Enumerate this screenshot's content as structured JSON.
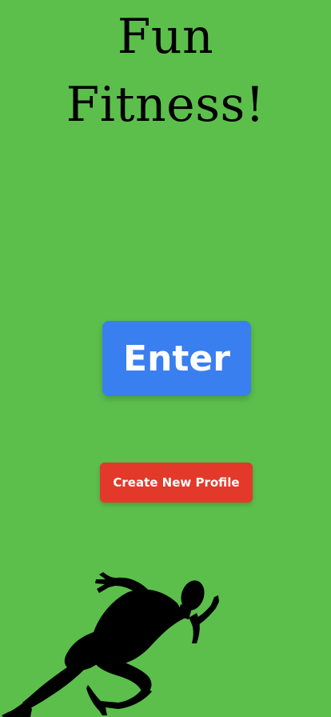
{
  "app": {
    "title_line_1": "Fun",
    "title_line_2": "Fitness!"
  },
  "actions": {
    "enter_label": "Enter",
    "create_profile_label": "Create New Profile"
  },
  "illustration": {
    "icon": "runner-silhouette-icon"
  },
  "colors": {
    "background": "#5cbf4c",
    "enter_button": "#3a7ff0",
    "create_button": "#e2392a",
    "title_text": "#000000"
  }
}
